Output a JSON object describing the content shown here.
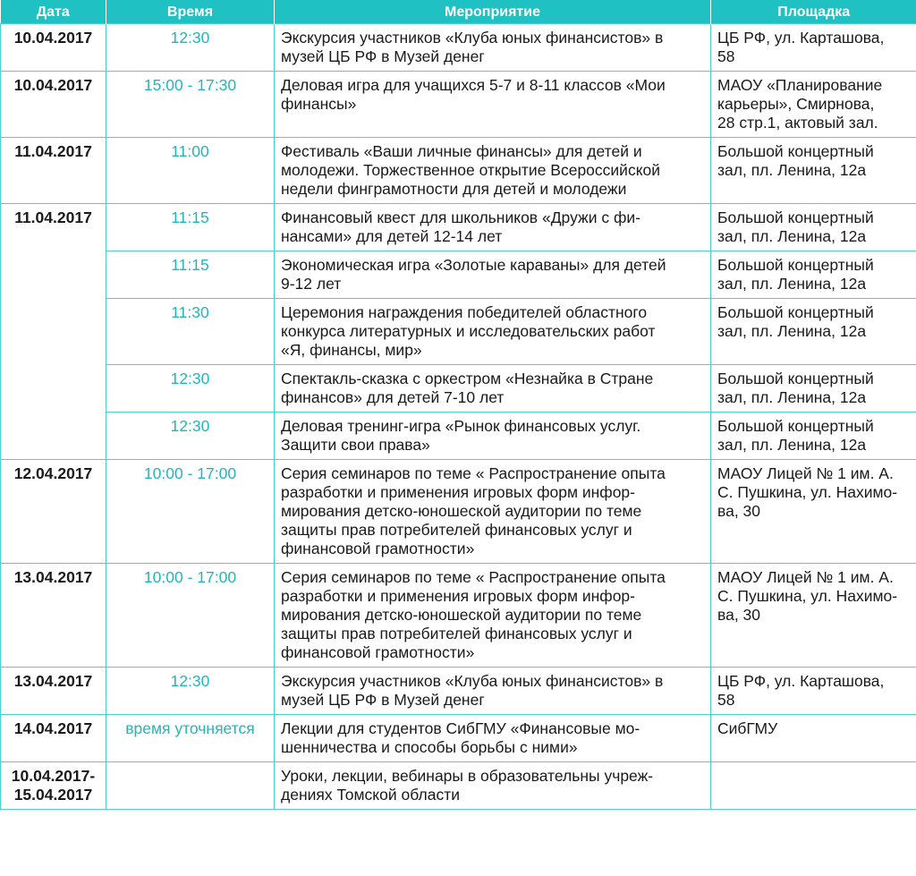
{
  "table": {
    "headers": {
      "date": "Дата",
      "time": "Время",
      "event": "Мероприятие",
      "venue": "Площадка"
    },
    "rows": [
      {
        "date": "10.04.2017",
        "time": "12:30",
        "event": [
          "Экскурсия участников «Клуба юных финансистов» в",
          "музей ЦБ РФ в Музей денег"
        ],
        "venue": [
          "ЦБ РФ, ул. Карташова,",
          "58"
        ]
      },
      {
        "date": "10.04.2017",
        "time": "15:00 - 17:30",
        "event": [
          "Деловая игра для учащихся 5-7 и 8-11 классов «Мои",
          "финансы»"
        ],
        "venue": [
          "МАОУ «Планирование",
          "карьеры», Смирнова,",
          "28 стр.1, актовый зал."
        ]
      },
      {
        "date": "11.04.2017",
        "time": "11:00",
        "event": [
          "Фестиваль «Ваши личные финансы» для детей и",
          "молодежи. Торжественное открытие Всероссийской",
          "недели финграмотности для детей и молодежи"
        ],
        "venue": [
          "Большой концертный",
          "зал, пл. Ленина, 12а"
        ]
      },
      {
        "date": "11.04.2017",
        "time": "11:15",
        "event": [
          "Финансовый квест для школьников «Дружи с фи-",
          "нансами» для детей 12-14 лет"
        ],
        "venue": [
          "Большой концертный",
          "зал, пл. Ленина, 12а"
        ]
      },
      {
        "date": "",
        "time": "11:15",
        "event": [
          "Экономическая игра «Золотые караваны» для детей",
          "9-12 лет"
        ],
        "venue": [
          "Большой концертный",
          "зал, пл. Ленина, 12а"
        ]
      },
      {
        "date": "",
        "time": "11:30",
        "event": [
          "Церемония награждения победителей областного",
          "конкурса литературных и исследовательских работ",
          "«Я, финансы, мир»"
        ],
        "venue": [
          "Большой концертный",
          "зал, пл. Ленина, 12а"
        ]
      },
      {
        "date": "",
        "time": "12:30",
        "event": [
          "Спектакль-сказка с оркестром «Незнайка в Стране",
          "финансов» для детей 7-10 лет"
        ],
        "venue": [
          "Большой концертный",
          "зал, пл. Ленина, 12а"
        ]
      },
      {
        "date": "",
        "time": "12:30",
        "event": [
          "Деловая тренинг-игра «Рынок финансовых услуг.",
          "Защити свои права»"
        ],
        "venue": [
          "Большой концертный",
          "зал, пл. Ленина, 12а"
        ]
      },
      {
        "date": "12.04.2017",
        "time": "10:00 - 17:00",
        "event": [
          "Серия семинаров по теме « Распространение опыта",
          "разработки и применения игровых форм инфор-",
          "мирования детско-юношеской аудитории по теме",
          "защиты прав потребителей финансовых услуг и",
          "финансовой грамотности»"
        ],
        "venue": [
          "МАОУ Лицей № 1 им. А.",
          "С. Пушкина, ул. Нахимо-",
          "ва, 30"
        ]
      },
      {
        "date": "13.04.2017",
        "time": "10:00 - 17:00",
        "event": [
          "Серия семинаров по теме « Распространение опыта",
          "разработки и применения игровых форм инфор-",
          "мирования детско-юношеской аудитории по теме",
          "защиты прав потребителей финансовых услуг и",
          "финансовой грамотности»"
        ],
        "venue": [
          "МАОУ Лицей № 1 им. А.",
          "С. Пушкина, ул. Нахимо-",
          "ва, 30"
        ]
      },
      {
        "date": "13.04.2017",
        "time": "12:30",
        "event": [
          "Экскурсия участников «Клуба юных финансистов» в",
          "музей ЦБ РФ в Музей денег"
        ],
        "venue": [
          "ЦБ РФ, ул. Карташова,",
          "58"
        ]
      },
      {
        "date": "14.04.2017",
        "time": "время уточняется",
        "event": [
          "Лекции для студентов СибГМУ «Финансовые мо-",
          "шенничества и способы борьбы с ними»"
        ],
        "venue": [
          "СибГМУ"
        ]
      },
      {
        "date": "10.04.2017-\n15.04.2017",
        "time": "",
        "event": [
          "Уроки, лекции, вебинары в образовательны учреж-",
          "дениях Томской области"
        ],
        "venue": [
          ""
        ]
      }
    ]
  }
}
